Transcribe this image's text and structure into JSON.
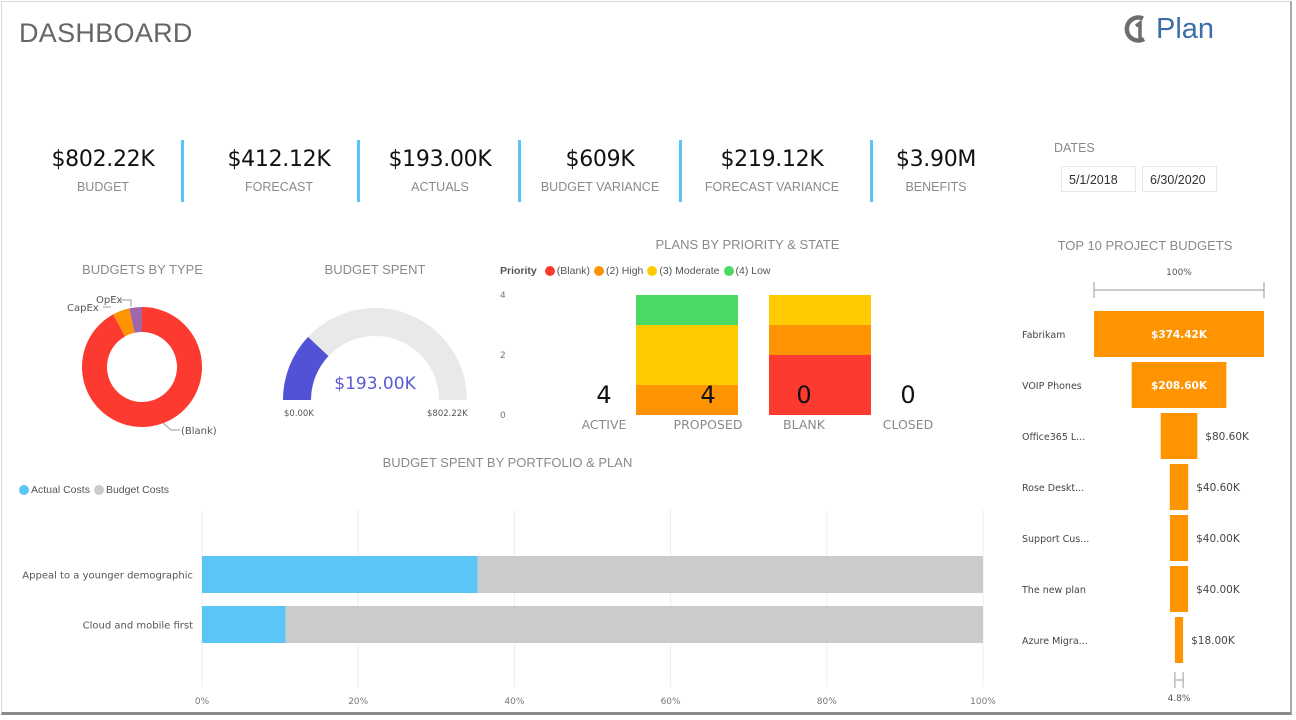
{
  "header": {
    "title": "DASHBOARD",
    "logo_text": "Plan",
    "logo_icon": "one-circle-logo-icon"
  },
  "kpis": [
    {
      "value": "$802.22K",
      "label": "BUDGET"
    },
    {
      "value": "$412.12K",
      "label": "FORECAST"
    },
    {
      "value": "$193.00K",
      "label": "ACTUALS"
    },
    {
      "value": "$609K",
      "label": "BUDGET VARIANCE"
    },
    {
      "value": "$219.12K",
      "label": "FORECAST VARIANCE"
    },
    {
      "value": "$3.90M",
      "label": "BENEFITS"
    }
  ],
  "dates": {
    "label": "DATES",
    "start": "5/1/2018",
    "end": "6/30/2020"
  },
  "colors": {
    "kpi_separator": "#5bc5f5",
    "blank": "#fd3a30",
    "high": "#fe9401",
    "moderate": "#fecb00",
    "low": "#4cd964",
    "opex": "#a066aa",
    "gauge_fill": "#5252d6",
    "gauge_track": "#e9e9e9",
    "actual_costs": "#5bc5f5",
    "budget_costs": "#cbcbcb",
    "funnel": "#fe9401"
  },
  "chart_data": [
    {
      "id": "budgets-by-type",
      "type": "pie",
      "variant": "donut",
      "title": "BUDGETS BY TYPE",
      "slices": [
        {
          "label": "(Blank)",
          "value": 92.0,
          "color": "#fd3a30"
        },
        {
          "label": "CapEx",
          "value": 4.6,
          "color": "#fe9401"
        },
        {
          "label": "OpEx",
          "value": 3.4,
          "color": "#a066aa"
        }
      ],
      "legend": "none"
    },
    {
      "id": "budget-spent",
      "type": "gauge",
      "title": "BUDGET SPENT",
      "value": 193.0,
      "min": 0,
      "max": 802.22,
      "value_label": "$193.00K",
      "min_label": "$0.00K",
      "max_label": "$802.22K"
    },
    {
      "id": "plans-by-priority-state",
      "type": "bar",
      "stacked": true,
      "title": "PLANS BY PRIORITY & STATE",
      "legend_title": "Priority",
      "legend": "top-left",
      "categories": [
        "ACTIVE",
        "PROPOSED",
        "BLANK",
        "CLOSED"
      ],
      "category_counts": [
        "4",
        "4",
        "0",
        "0"
      ],
      "series": [
        {
          "name": "(Blank)",
          "color": "#fd3a30",
          "values": [
            0,
            0,
            2,
            0
          ]
        },
        {
          "name": "(2) High",
          "color": "#fe9401",
          "values": [
            0,
            1,
            1,
            0
          ]
        },
        {
          "name": "(3) Moderate",
          "color": "#fecb00",
          "values": [
            0,
            2,
            1,
            0
          ]
        },
        {
          "name": "(4) Low",
          "color": "#4cd964",
          "values": [
            0,
            1,
            0,
            0
          ]
        }
      ],
      "yticks": [
        "0",
        "2",
        "4"
      ],
      "ylim": [
        0,
        4
      ],
      "grid": false
    },
    {
      "id": "top-10-project-budgets",
      "type": "bar",
      "variant": "funnel",
      "title": "TOP 10 PROJECT BUDGETS",
      "top_label": "100%",
      "bottom_label": "4.8%",
      "categories": [
        "Fabrikam",
        "VOIP Phones",
        "Office365 L...",
        "Rose Deskt...",
        "Support Cus...",
        "The new plan",
        "Azure Migra..."
      ],
      "values": [
        374.42,
        208.6,
        80.6,
        40.6,
        40.0,
        40.0,
        18.0
      ],
      "value_labels": [
        "$374.42K",
        "$208.60K",
        "$80.60K",
        "$40.60K",
        "$40.00K",
        "$40.00K",
        "$18.00K"
      ],
      "unit": "K USD"
    },
    {
      "id": "budget-spent-by-portfolio-plan",
      "type": "bar",
      "orientation": "horizontal",
      "stacked": true,
      "percent": true,
      "title": "BUDGET SPENT BY PORTFOLIO & PLAN",
      "legend": "top-left",
      "categories": [
        "Appeal to a younger demographic",
        "Cloud and mobile first"
      ],
      "series": [
        {
          "name": "Actual Costs",
          "color": "#5bc5f5",
          "values": [
            35.3,
            10.7
          ]
        },
        {
          "name": "Budget Costs",
          "color": "#cbcbcb",
          "values": [
            64.7,
            89.3
          ]
        }
      ],
      "xticks": [
        "0%",
        "20%",
        "40%",
        "60%",
        "80%",
        "100%"
      ],
      "xlim": [
        0,
        100
      ],
      "grid": true
    }
  ]
}
